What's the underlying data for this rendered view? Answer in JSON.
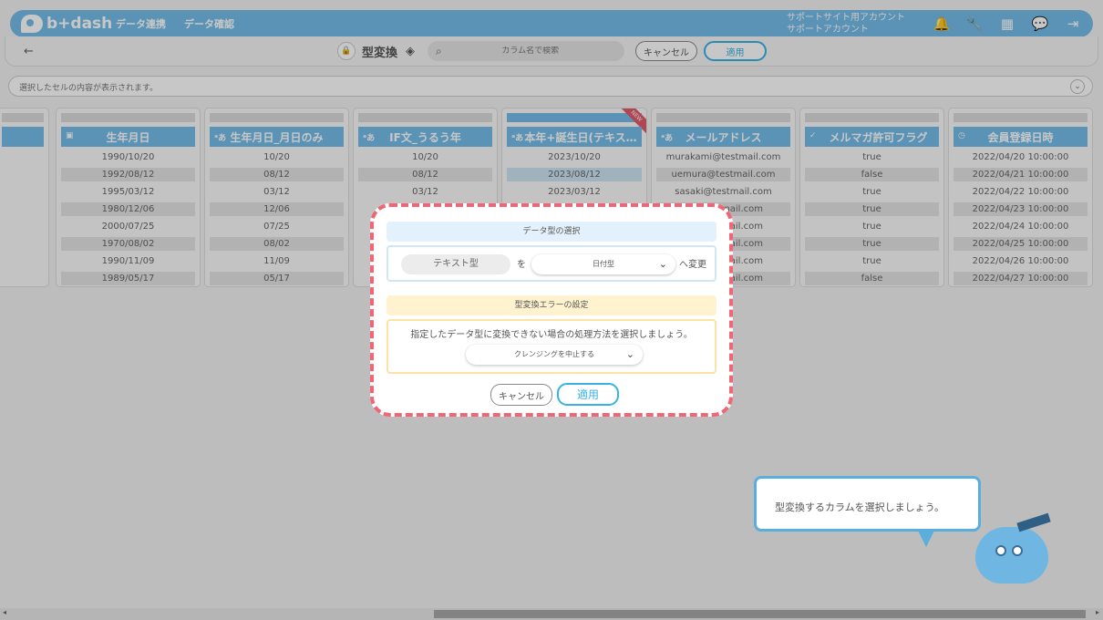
{
  "header": {
    "logo": "b+dash",
    "nav": [
      "データ連携",
      "データ確認"
    ],
    "account": [
      "サポートサイト用アカウント",
      "サポートアカウント"
    ]
  },
  "toolbar": {
    "back": "←",
    "title": "型変換",
    "search_placeholder": "カラム名で検索",
    "cancel": "キャンセル",
    "apply": "適用"
  },
  "cellbar": {
    "placeholder": "選択したセルの内容が表示されます。"
  },
  "columns": [
    {
      "name": "",
      "rows": []
    },
    {
      "name": "生年月日",
      "rows": [
        "1990/10/20",
        "1992/08/12",
        "1995/03/12",
        "1980/12/06",
        "2000/07/25",
        "1970/08/02",
        "1990/11/09",
        "1989/05/17"
      ]
    },
    {
      "name": "生年月日_月日のみ",
      "rows": [
        "10/20",
        "08/12",
        "03/12",
        "12/06",
        "07/25",
        "08/02",
        "11/09",
        "05/17"
      ]
    },
    {
      "name": "IF文_うるう年",
      "rows": [
        "10/20",
        "08/12",
        "03/12"
      ]
    },
    {
      "name": "本年+誕生日(テキス…",
      "ribbon": "NEW",
      "rows": [
        "2023/10/20",
        "2023/08/12",
        "2023/03/12"
      ]
    },
    {
      "name": "メールアドレス",
      "rows": [
        "murakami@testmail.com",
        "uemura@testmail.com",
        "sasaki@testmail.com",
        "nail.com",
        "nail.com",
        "nail.com",
        "nail.com",
        "nail.com"
      ]
    },
    {
      "name": "メルマガ許可フラグ",
      "rows": [
        "true",
        "false",
        "true",
        "true",
        "true",
        "true",
        "true",
        "false"
      ]
    },
    {
      "name": "会員登録日時",
      "rows": [
        "2022/04/20 10:00:00",
        "2022/04/21 10:00:00",
        "2022/04/22 10:00:00",
        "2022/04/23 10:00:00",
        "2022/04/24 10:00:00",
        "2022/04/25 10:00:00",
        "2022/04/26 10:00:00",
        "2022/04/27 10:00:00"
      ]
    }
  ],
  "modal": {
    "type_section_title": "データ型の選択",
    "from_type": "テキスト型",
    "particle": "を",
    "to_type": "日付型",
    "change_suffix": "へ変更",
    "error_section_title": "型変換エラーの設定",
    "error_text": "指定したデータ型に変換できない場合の処理方法を選択しましょう。",
    "error_option": "クレンジングを中止する",
    "cancel": "キャンセル",
    "apply": "適用"
  },
  "hint": {
    "text": "型変換するカラムを選択しましょう。"
  },
  "colors": {
    "brand": "#74bde8",
    "accent": "#38b2e4",
    "dash": "#f06676",
    "hint_border": "#5aaedb"
  }
}
